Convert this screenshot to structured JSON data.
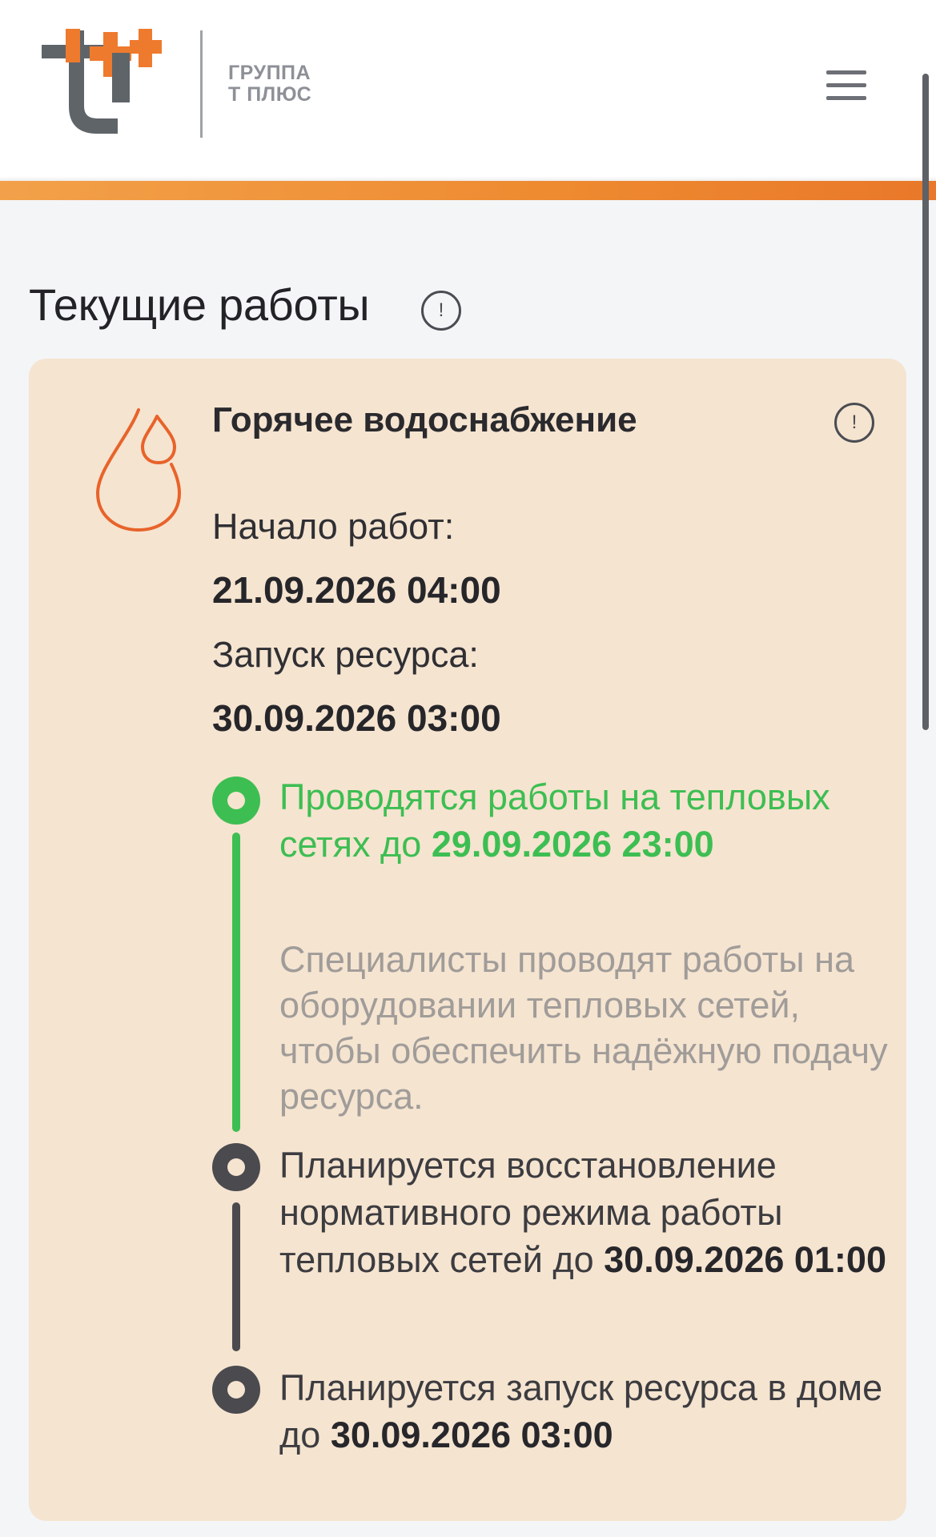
{
  "header": {
    "logo_text_line1": "ГРУППА",
    "logo_text_line2": "Т ПЛЮС",
    "brand_colors": {
      "orange": "#ee7a2e",
      "gray": "#5f6469"
    }
  },
  "section": {
    "title": "Текущие работы",
    "info_icon": "!"
  },
  "card": {
    "icon": "water-drop-icon",
    "title": "Горячее водоснабжение",
    "info_icon": "!",
    "start_label": "Начало работ:",
    "start_value": "21.09.2026 04:00",
    "launch_label": "Запуск ресурса:",
    "launch_value": "30.09.2026 03:00"
  },
  "timeline": [
    {
      "status": "active",
      "text": "Проводятся работы на тепловых сетях до",
      "date": "29.09.2026 23:00",
      "description": "Специалисты проводят работы на оборудовании тепловых сетей, чтобы обеспечить надёжную подачу ресурса."
    },
    {
      "status": "planned",
      "text": "Планируется восстановление нормативного режима работы тепловых сетей до",
      "date": "30.09.2026 01:00"
    },
    {
      "status": "planned",
      "text": "Планируется запуск ресурса в доме до",
      "date": "30.09.2026 03:00"
    }
  ],
  "colors": {
    "active_green": "#3dbe52",
    "planned_dark": "#4a4a4f",
    "card_bg": "#f5e4d0",
    "accent_orange": "#ee8a30"
  }
}
